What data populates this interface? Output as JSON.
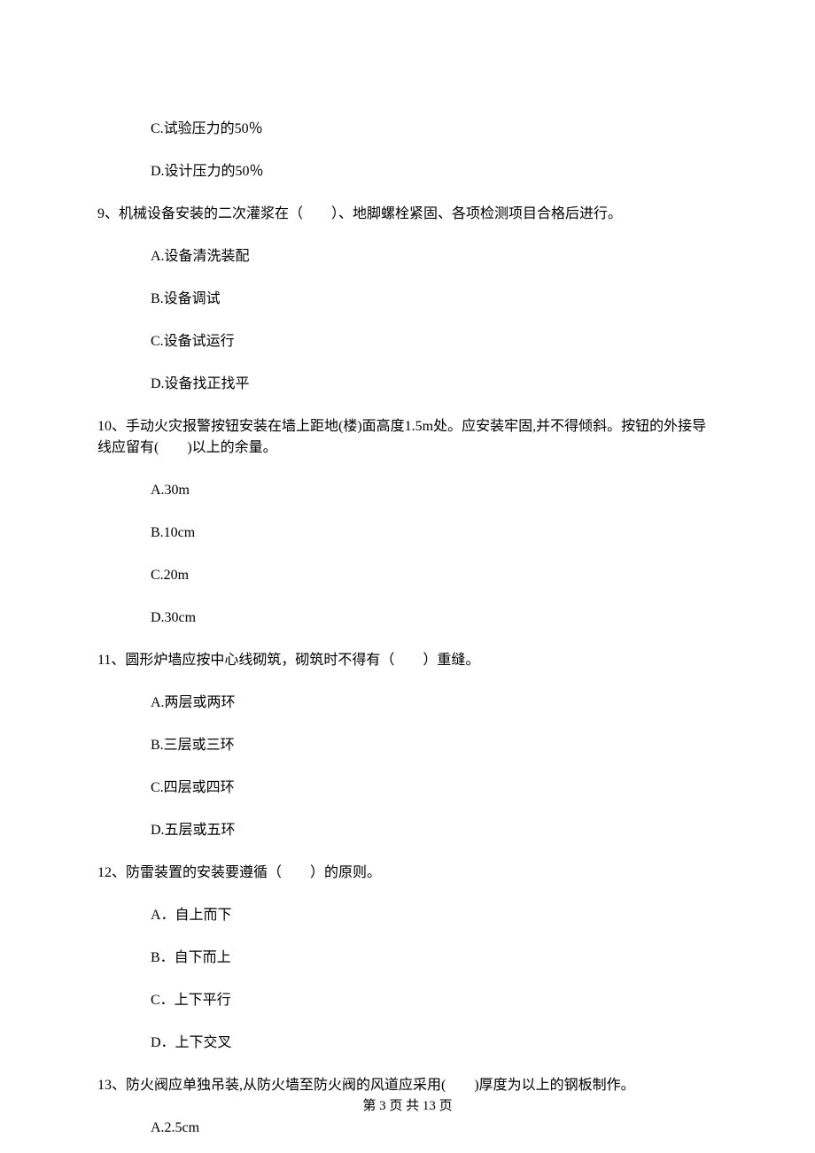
{
  "orphan_options": {
    "c": "C.试验压力的50％",
    "d": "D.设计压力的50％"
  },
  "q9": {
    "stem": "9、机械设备安装的二次灌浆在（　　）、地脚螺栓紧固、各项检测项目合格后进行。",
    "a": "A.设备清洗装配",
    "b": "B.设备调试",
    "c": "C.设备试运行",
    "d": "D.设备找正找平"
  },
  "q10": {
    "stem": "10、手动火灾报警按钮安装在墙上距地(楼)面高度1.5m处。应安装牢固,并不得倾斜。按钮的外接导线应留有(　　)以上的余量。",
    "a": "A.30m",
    "b": "B.10cm",
    "c": "C.20m",
    "d": "D.30cm"
  },
  "q11": {
    "stem": "11、圆形炉墙应按中心线砌筑，砌筑时不得有（　　）重缝。",
    "a": "A.两层或两环",
    "b": "B.三层或三环",
    "c": "C.四层或四环",
    "d": "D.五层或五环"
  },
  "q12": {
    "stem": "12、防雷装置的安装要遵循（　　）的原则。",
    "a": "A．自上而下",
    "b": "B．自下而上",
    "c": "C．上下平行",
    "d": "D．上下交叉"
  },
  "q13": {
    "stem": "13、防火阀应单独吊装,从防火墙至防火阀的风道应采用(　　)厚度为以上的钢板制作。",
    "a": "A.2.5cm"
  },
  "footer": "第 3 页 共 13 页"
}
